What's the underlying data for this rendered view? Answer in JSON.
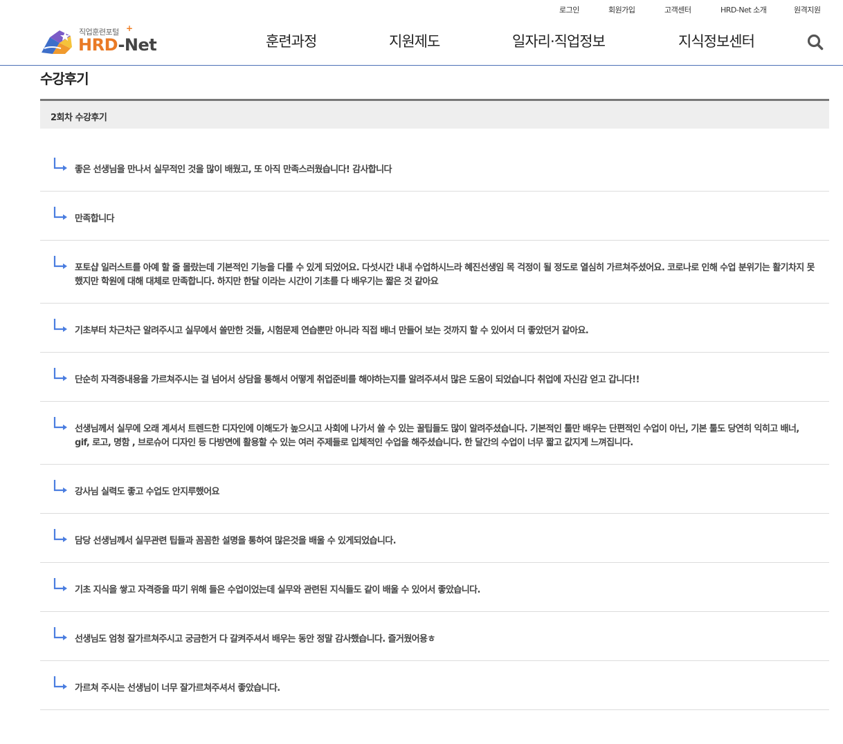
{
  "util_nav": [
    {
      "label": "로그인"
    },
    {
      "label": "회원가입"
    },
    {
      "label": "고객센터"
    },
    {
      "label": "HRD-Net 소개"
    },
    {
      "label": "원격지원"
    }
  ],
  "logo": {
    "subtitle": "직업훈련포털",
    "plus": "+",
    "brand_main": "HRD",
    "brand_suffix": "-Net"
  },
  "gnb": [
    {
      "label": "훈련과정"
    },
    {
      "label": "지원제도"
    },
    {
      "label": "일자리·직업정보"
    },
    {
      "label": "지식정보센터"
    }
  ],
  "search_icon": "search-icon",
  "page_title": "수강후기",
  "board_header": "2회차 수강후기",
  "colors": {
    "accent_line": "#4a6fb5",
    "logo_orange": "#e97a26",
    "arrow_blue": "#4a7de0"
  },
  "reviews": [
    {
      "text": "좋은 선생님을 만나서 실무적인 것을 많이 배웠고, 또 아직 만족스러웠습니다! 감사합니다"
    },
    {
      "text": "만족합니다"
    },
    {
      "text": "포토샵 일러스트를 아예 할 줄 몰랐는데 기본적인 기능을 다룰 수 있게 되었어요. 다섯시간 내내 수업하시느라 혜진선생임 목 걱정이 될 정도로 열심히 가르쳐주셨어요. 코로나로 인해 수업 분위기는 활기차지 못했지만 학원에 대해 대체로 만족합니다. 하지만 한달 이라는 시간이 기초를 다 배우기는 짧은 것 같아요"
    },
    {
      "text": "기초부터 차근차근 알려주시고 실무에서 쓸만한 것들, 시험문제 연습뿐만 아니라 직접 배너 만들어 보는 것까지 할 수 있어서 더 좋았던거 같아요."
    },
    {
      "text": "단순히 자격증내용을 가르쳐주시는 걸 넘어서 상담을 통해서 어떻게 취업준비를 해야하는지를 알려주셔서 많은 도움이 되었습니다 취업에 자신감 얻고 갑니다!!"
    },
    {
      "text": "선생님께서 실무에 오래 계셔서 트렌드한 디자인에 이해도가 높으시고 사회에 나가서 쓸 수 있는 꿀팁들도 많이 알려주셨습니다. 기본적인 툴만 배우는 단편적인 수업이 아닌, 기본 툴도 당연히 익히고 배너, gif, 로고, 명함 , 브로슈어 디자인 등 다방면에 활용할 수 있는 여러 주제들로 입체적인 수업을 해주셨습니다. 한 달간의 수업이 너무 짧고 값지게 느껴집니다."
    },
    {
      "text": "강사님 실력도 좋고 수업도 안지루했어요"
    },
    {
      "text": "담당 선생님께서 실무관련 팁들과 꼼꼼한 설명을 통하여 많은것을 배울 수 있게되었습니다."
    },
    {
      "text": "기초 지식을 쌓고 자격증을 따기 위해 들은 수업이었는데 실무와 관련된 지식들도 같이 배울 수 있어서 좋았습니다."
    },
    {
      "text": "선생님도 엄청 잘가르쳐주시고 궁금한거 다 갈켜주셔서 배우는 동안 정말 감사했습니다. 즐거웠어용ㅎ"
    },
    {
      "text": "가르쳐 주시는 선생님이 너무 잘가르쳐주셔서 좋았습니다."
    }
  ]
}
